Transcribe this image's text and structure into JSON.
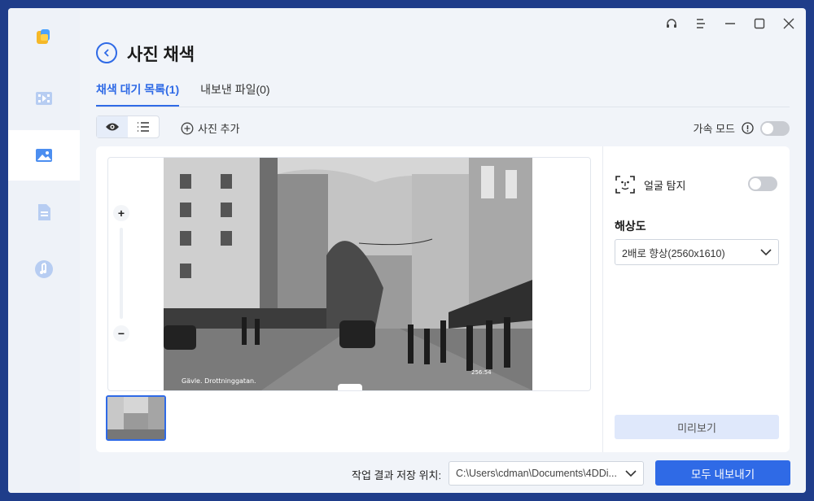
{
  "page": {
    "title": "사진 채색"
  },
  "tabs": [
    {
      "label": "채색 대기 목록(1)"
    },
    {
      "label": "내보낸 파일(0)"
    }
  ],
  "toolbar": {
    "add_photo": "사진 추가",
    "accel_mode": "가속 모드"
  },
  "photo": {
    "caption_left": "Gävle. Drottninggatan.",
    "caption_right_code": "256:54"
  },
  "right_pane": {
    "face_detect": "얼굴 탐지",
    "resolution_label": "해상도",
    "resolution_value": "2배로 향상(2560x1610)",
    "preview_button": "미리보기"
  },
  "footer": {
    "save_label": "작업 결과 저장 위치:",
    "save_path": "C:\\Users\\cdman\\Documents\\4DDi...",
    "export_button": "모두 내보내기"
  },
  "colors": {
    "accent": "#2f6ae6",
    "desktop": "#1f3d8a"
  },
  "icons": {
    "sidebar": [
      "video-icon",
      "image-icon",
      "document-icon",
      "music-icon"
    ],
    "window": [
      "headset-icon",
      "menu-icon",
      "minimize-icon",
      "maximize-icon",
      "close-icon"
    ]
  }
}
